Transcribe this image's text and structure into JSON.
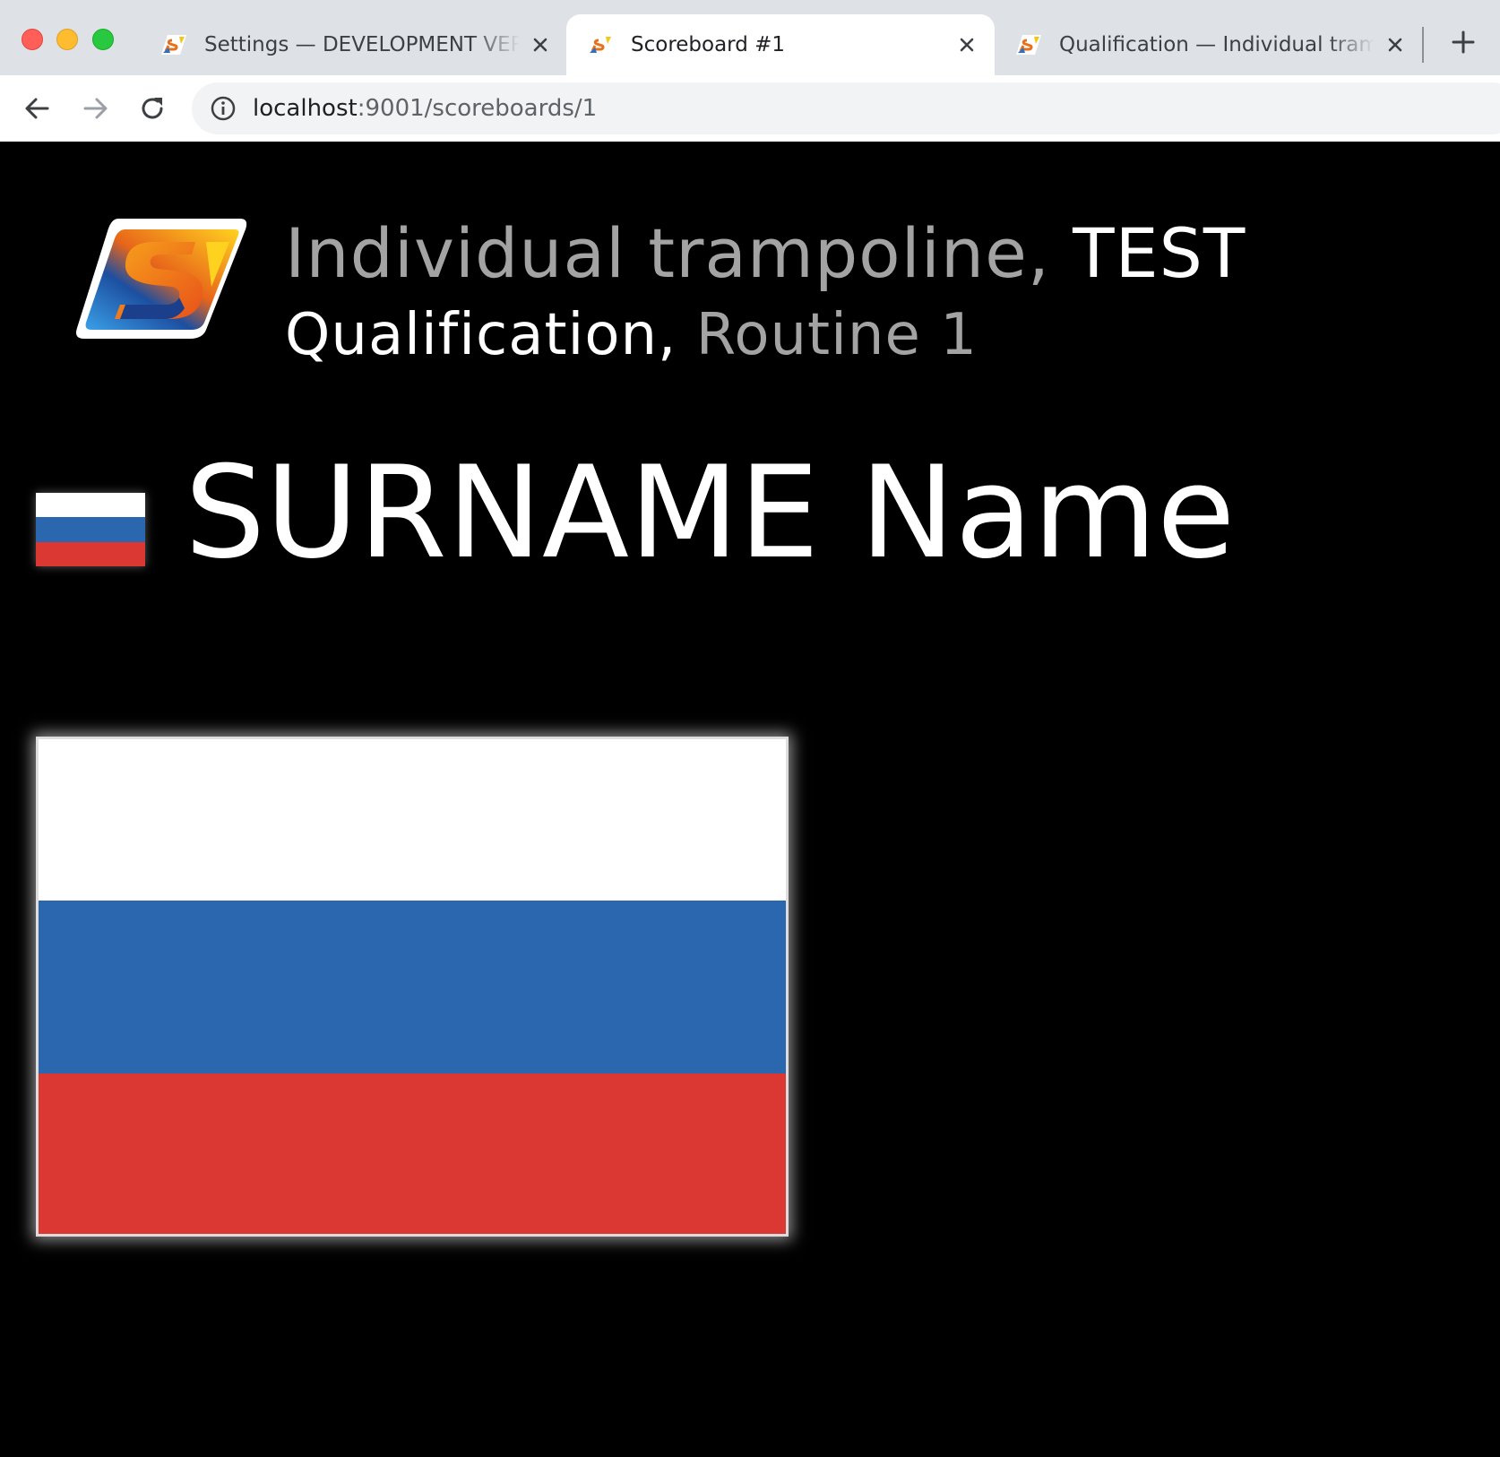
{
  "browser": {
    "tabs": [
      {
        "title": "Settings — DEVELOPMENT VERSION",
        "active": false
      },
      {
        "title": "Scoreboard #1",
        "active": true
      },
      {
        "title": "Qualification — Individual trampoline",
        "active": false
      }
    ],
    "url_host": "localhost",
    "url_path": ":9001/scoreboards/1"
  },
  "scoreboard": {
    "competition_name": "Individual trampoline,",
    "competition_tag": "TEST",
    "stage": "Qualification,",
    "routine": "Routine 1",
    "athlete_name": "SURNAME Name",
    "country_flag": {
      "name": "russia-flag",
      "colors": [
        "#ffffff",
        "#2a67ae",
        "#dc3833"
      ]
    }
  },
  "colors": {
    "page_bg": "#000000",
    "text_primary": "#ffffff",
    "text_secondary": "#a3a3a3",
    "tabstrip_bg": "#dee1e6"
  }
}
